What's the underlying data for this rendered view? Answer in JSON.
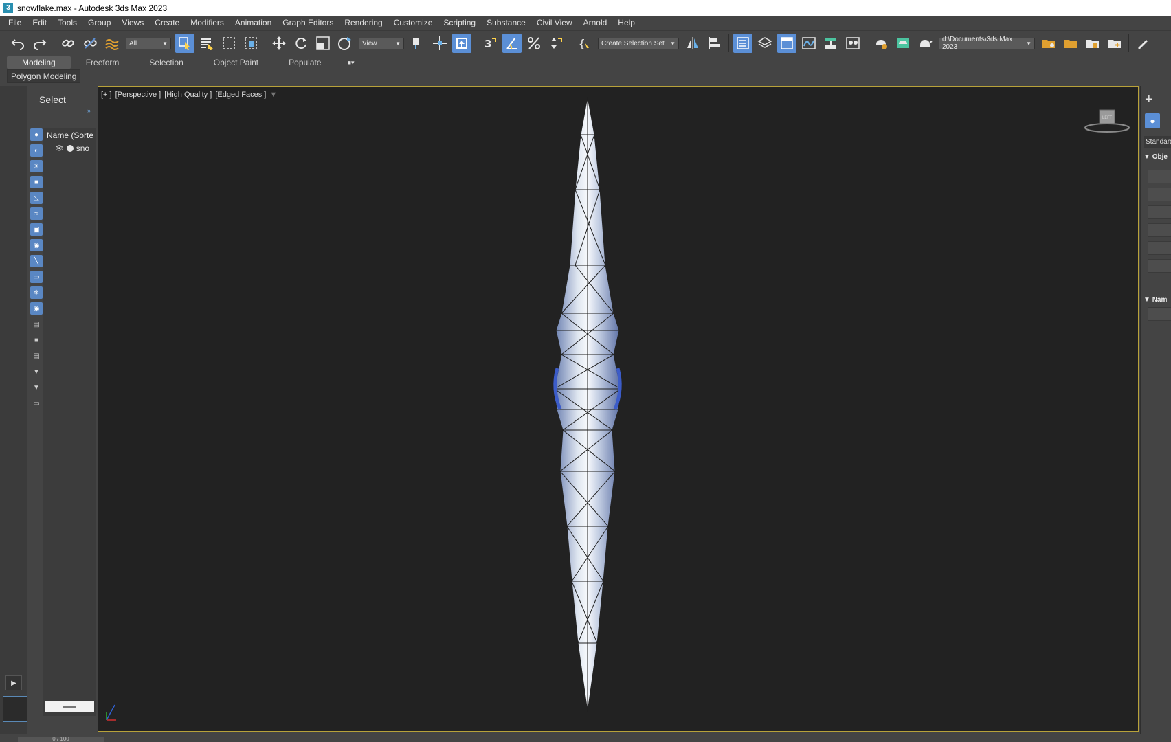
{
  "window": {
    "app_icon": "3",
    "title": "snowflake.max - Autodesk 3ds Max 2023"
  },
  "menubar": {
    "items": [
      "File",
      "Edit",
      "Tools",
      "Group",
      "Views",
      "Create",
      "Modifiers",
      "Animation",
      "Graph Editors",
      "Rendering",
      "Customize",
      "Scripting",
      "Substance",
      "Civil View",
      "Arnold",
      "Help"
    ]
  },
  "toolbar": {
    "selection_filter": "All",
    "reference_coord": "View",
    "selection_set_placeholder": "Create Selection Set",
    "project_path": "d:\\Documents\\3ds Max 2023",
    "snap_label": "3"
  },
  "ribbon": {
    "tabs": [
      "Modeling",
      "Freeform",
      "Selection",
      "Object Paint",
      "Populate"
    ],
    "active_tab": "Modeling",
    "sub_label": "Polygon Modeling"
  },
  "explorer": {
    "select_label": "Select",
    "more": "»",
    "column_header": "Name (Sorte",
    "rows": [
      {
        "name": "sno"
      }
    ]
  },
  "viewport": {
    "label_plus": "[+ ]",
    "label_view": "[Perspective ]",
    "label_quality": "[High Quality ]",
    "label_shading": "[Edged Faces ]",
    "viewcube_face": "LEFT"
  },
  "command_panel": {
    "dropdown": "Standard",
    "rollout_object": "Obje",
    "rollout_name": "Nam"
  },
  "timeline": {
    "frame": "0 / 100"
  }
}
